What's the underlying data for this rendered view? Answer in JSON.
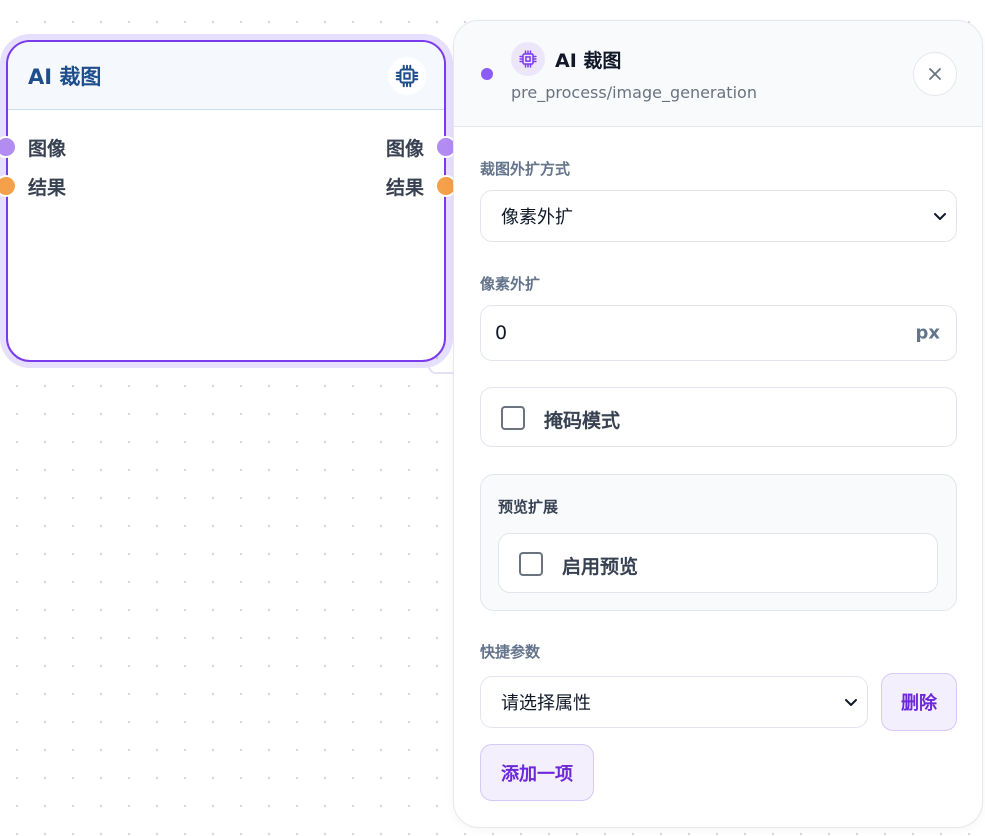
{
  "node": {
    "title": "AI 裁图",
    "icon": "cpu-chip-icon",
    "inputs": [
      {
        "label": "图像",
        "color": "#b28cf0"
      },
      {
        "label": "结果",
        "color": "#f5a04a"
      }
    ],
    "outputs": [
      {
        "label": "图像",
        "color": "#b28cf0"
      },
      {
        "label": "结果",
        "color": "#f5a04a"
      }
    ]
  },
  "panel": {
    "title": "AI 裁图",
    "subtitle": "pre_process/image_generation",
    "close_icon": "close-icon",
    "crop_mode": {
      "label": "裁图外扩方式",
      "value": "像素外扩"
    },
    "pixel_expand": {
      "label": "像素外扩",
      "value": "0",
      "unit": "px"
    },
    "mask_mode": {
      "label": "掩码模式",
      "checked": false
    },
    "preview": {
      "section_title": "预览扩展",
      "enable_label": "启用预览",
      "checked": false
    },
    "quick_params": {
      "label": "快捷参数",
      "select_placeholder": "请选择属性",
      "delete_label": "删除",
      "add_label": "添加一项"
    }
  },
  "colors": {
    "accent": "#7c3aed",
    "node_title": "#1e4e8c",
    "port_purple": "#b28cf0",
    "port_orange": "#f5a04a"
  }
}
